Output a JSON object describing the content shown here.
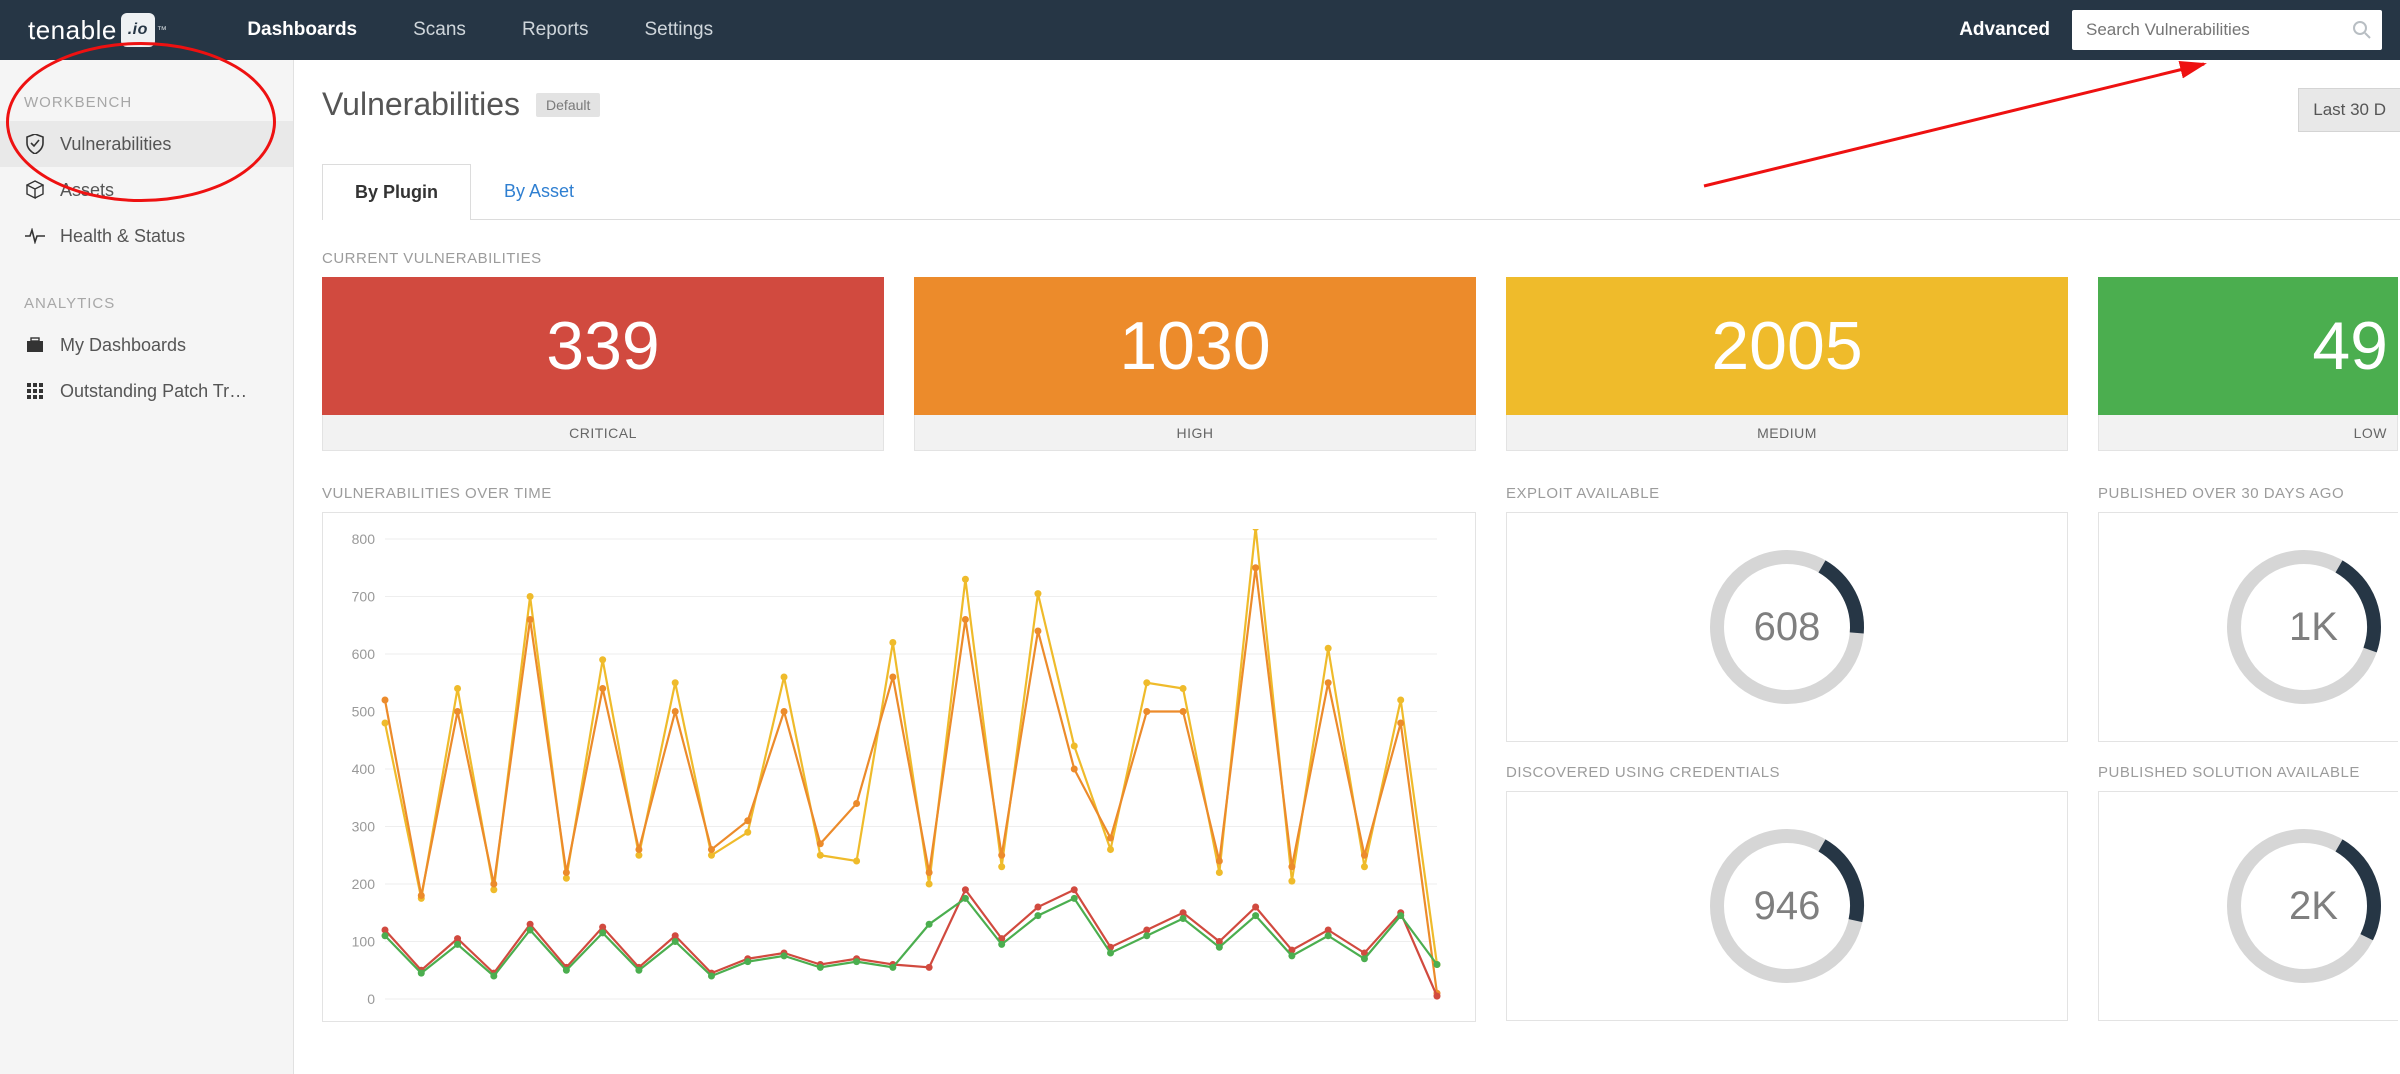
{
  "brand": {
    "name_a": "tenable",
    "name_b": ".io",
    "tm": "™"
  },
  "nav": {
    "items": [
      "Dashboards",
      "Scans",
      "Reports",
      "Settings"
    ],
    "active": 0,
    "advanced": "Advanced"
  },
  "search": {
    "placeholder": "Search Vulnerabilities"
  },
  "sidebar": {
    "sections": [
      {
        "label": "WORKBENCH",
        "items": [
          {
            "label": "Vulnerabilities",
            "icon": "shield-icon",
            "active": true
          },
          {
            "label": "Assets",
            "icon": "cube-icon"
          },
          {
            "label": "Health & Status",
            "icon": "pulse-icon"
          }
        ]
      },
      {
        "label": "ANALYTICS",
        "items": [
          {
            "label": "My Dashboards",
            "icon": "briefcase-icon"
          },
          {
            "label": "Outstanding Patch Tr…",
            "icon": "grid-icon"
          }
        ]
      }
    ]
  },
  "page": {
    "title": "Vulnerabilities",
    "badge": "Default",
    "date_range": "Last 30 D"
  },
  "tabs": {
    "items": [
      "By Plugin",
      "By Asset"
    ],
    "active": 0
  },
  "sections": {
    "current": "CURRENT VULNERABILITIES",
    "overtime": "VULNERABILITIES OVER TIME",
    "exploit": "EXPLOIT AVAILABLE",
    "pub30": "PUBLISHED OVER 30 DAYS AGO",
    "cred": "DISCOVERED USING CREDENTIALS",
    "solution": "PUBLISHED SOLUTION AVAILABLE"
  },
  "severity": [
    {
      "count": "339",
      "label": "CRITICAL",
      "color": "#d14a3f"
    },
    {
      "count": "1030",
      "label": "HIGH",
      "color": "#ec8b2b"
    },
    {
      "count": "2005",
      "label": "MEDIUM",
      "color": "#efbb2b"
    },
    {
      "count": "49",
      "label": "LOW",
      "color": "#4bae4f"
    }
  ],
  "donuts": {
    "exploit": {
      "value": "608",
      "pct": 18
    },
    "pub30": {
      "value": "1K",
      "pct": 22
    },
    "cred": {
      "value": "946",
      "pct": 20
    },
    "solution": {
      "value": "2K",
      "pct": 24
    }
  },
  "chart_data": {
    "type": "line",
    "title": "VULNERABILITIES OVER TIME",
    "xlabel": "",
    "ylabel": "",
    "ylim": [
      0,
      800
    ],
    "yticks": [
      0,
      100,
      200,
      300,
      400,
      500,
      600,
      700,
      800
    ],
    "x": [
      0,
      1,
      2,
      3,
      4,
      5,
      6,
      7,
      8,
      9,
      10,
      11,
      12,
      13,
      14,
      15,
      16,
      17,
      18,
      19,
      20,
      21,
      22,
      23,
      24,
      25,
      26,
      27,
      28,
      29
    ],
    "series": [
      {
        "name": "Medium",
        "color": "#efbb2b",
        "values": [
          480,
          175,
          540,
          190,
          700,
          210,
          590,
          250,
          550,
          250,
          290,
          560,
          250,
          240,
          620,
          200,
          730,
          230,
          705,
          440,
          260,
          550,
          540,
          220,
          820,
          205,
          610,
          230,
          520,
          60
        ]
      },
      {
        "name": "High",
        "color": "#ec8b2b",
        "values": [
          520,
          180,
          500,
          200,
          660,
          220,
          540,
          260,
          500,
          260,
          310,
          500,
          270,
          340,
          560,
          220,
          660,
          250,
          640,
          400,
          280,
          500,
          500,
          240,
          750,
          230,
          550,
          250,
          480,
          10
        ]
      },
      {
        "name": "Critical",
        "color": "#d14a3f",
        "values": [
          120,
          50,
          105,
          45,
          130,
          55,
          125,
          55,
          110,
          45,
          70,
          80,
          60,
          70,
          60,
          55,
          190,
          105,
          160,
          190,
          90,
          120,
          150,
          100,
          160,
          85,
          120,
          80,
          150,
          5
        ]
      },
      {
        "name": "Low",
        "color": "#4bae4f",
        "values": [
          110,
          45,
          95,
          40,
          120,
          50,
          115,
          50,
          100,
          40,
          65,
          75,
          55,
          65,
          55,
          130,
          175,
          95,
          145,
          175,
          80,
          110,
          140,
          90,
          145,
          75,
          110,
          70,
          145,
          60
        ]
      }
    ]
  }
}
